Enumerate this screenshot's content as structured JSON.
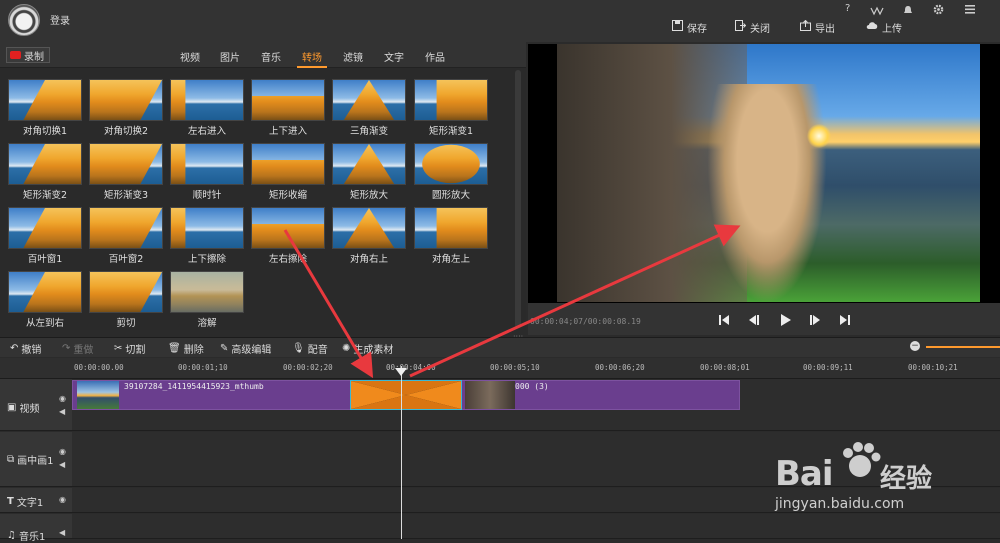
{
  "app": {
    "login": "登录",
    "top_icons": [
      "?",
      "VIP",
      "通知",
      "设置",
      "菜单"
    ],
    "actions": [
      {
        "label": "保存",
        "icon": "save-icon"
      },
      {
        "label": "关闭",
        "icon": "close-icon"
      },
      {
        "label": "导出",
        "icon": "export-icon"
      },
      {
        "label": "上传",
        "icon": "upload-icon"
      }
    ]
  },
  "tabs": {
    "record": "录制",
    "items": [
      "视频",
      "图片",
      "音乐",
      "转场",
      "滤镜",
      "文字",
      "作品"
    ],
    "active": "转场"
  },
  "transitions": [
    "对角切换1",
    "对角切换2",
    "左右进入",
    "上下进入",
    "三角渐变",
    "矩形渐变1",
    "矩形渐变2",
    "矩形渐变3",
    "顺时针",
    "矩形收缩",
    "矩形放大",
    "圆形放大",
    "百叶窗1",
    "百叶窗2",
    "上下擦除",
    "左右擦除",
    "对角右上",
    "对角左上",
    "从左到右",
    "剪切",
    "溶解"
  ],
  "preview": {
    "timecode": "00:00:04;07/00:00:08.19"
  },
  "toolbar": {
    "undo": "撤销",
    "redo": "重做",
    "cut": "切割",
    "delete": "删除",
    "advanced_edit": "高级编辑",
    "dub": "配音",
    "generate": "生成素材"
  },
  "ruler": [
    "00:00:00.00",
    "00:00:01;10",
    "00:00:02;20",
    "00:00:04;00",
    "00:00:05;10",
    "00:00:06;20",
    "00:00:08;01",
    "00:00:09;11",
    "00:00:10;21"
  ],
  "tracks": {
    "video": "视频",
    "pip": "画中画1",
    "text": "文字1",
    "music": "音乐1"
  },
  "clips": {
    "clip1_name": "39107284_1411954415923_mthumb",
    "clip2_name": "000 (3)"
  },
  "watermark": {
    "brand": "Bai",
    "brand_cn": "经验",
    "url": "jingyan.baidu.com"
  },
  "colors": {
    "accent": "#ff9a2e",
    "clip": "#6a3e8e",
    "transition_border": "#3ab8d6",
    "arrow": "#e8393e"
  }
}
